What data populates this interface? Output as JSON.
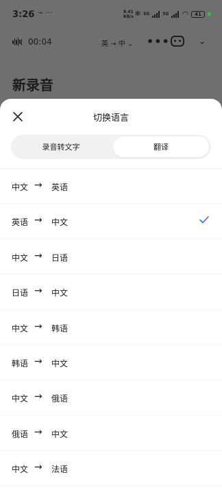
{
  "status": {
    "time": "3:26",
    "speed_value": "8.41",
    "speed_unit": "KB/s",
    "network_1": "5G",
    "network_2": "5G",
    "battery": "41",
    "left_icons": "⌁ ···"
  },
  "recording": {
    "elapsed": "00:04",
    "lang_pill": "英 → 中 ⌄",
    "more": "•••",
    "chevron": "⌄"
  },
  "page": {
    "title": "新录音"
  },
  "sheet": {
    "title": "切换语言",
    "segments": [
      {
        "label": "录音转文字",
        "selected": false
      },
      {
        "label": "翻译",
        "selected": true
      }
    ],
    "arrow": "→",
    "accent_color": "#3b6de0",
    "pairs": [
      {
        "src": "中文",
        "dst": "英语",
        "selected": false
      },
      {
        "src": "英语",
        "dst": "中文",
        "selected": true
      },
      {
        "src": "中文",
        "dst": "日语",
        "selected": false
      },
      {
        "src": "日语",
        "dst": "中文",
        "selected": false
      },
      {
        "src": "中文",
        "dst": "韩语",
        "selected": false
      },
      {
        "src": "韩语",
        "dst": "中文",
        "selected": false
      },
      {
        "src": "中文",
        "dst": "俄语",
        "selected": false
      },
      {
        "src": "俄语",
        "dst": "中文",
        "selected": false
      },
      {
        "src": "中文",
        "dst": "法语",
        "selected": false
      }
    ]
  }
}
